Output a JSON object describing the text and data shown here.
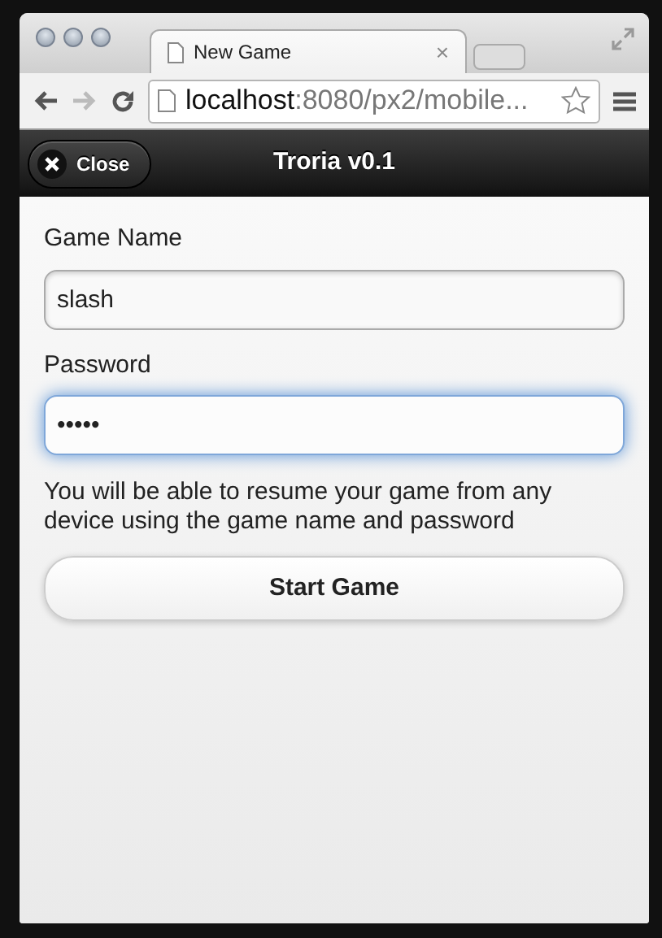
{
  "browser": {
    "tab": {
      "title": "New Game",
      "close": "×"
    },
    "url": {
      "host": "localhost",
      "path": ":8080/px2/mobile..."
    }
  },
  "header": {
    "close_button": "Close",
    "title": "Troria v0.1"
  },
  "form": {
    "fields": [
      {
        "label": "Game Name",
        "value": "slash",
        "focused": false
      },
      {
        "label": "Password",
        "value": "•••••",
        "focused": true
      }
    ],
    "note": "You will be able to resume your game from any device using the game name and password",
    "submit": "Start Game"
  }
}
